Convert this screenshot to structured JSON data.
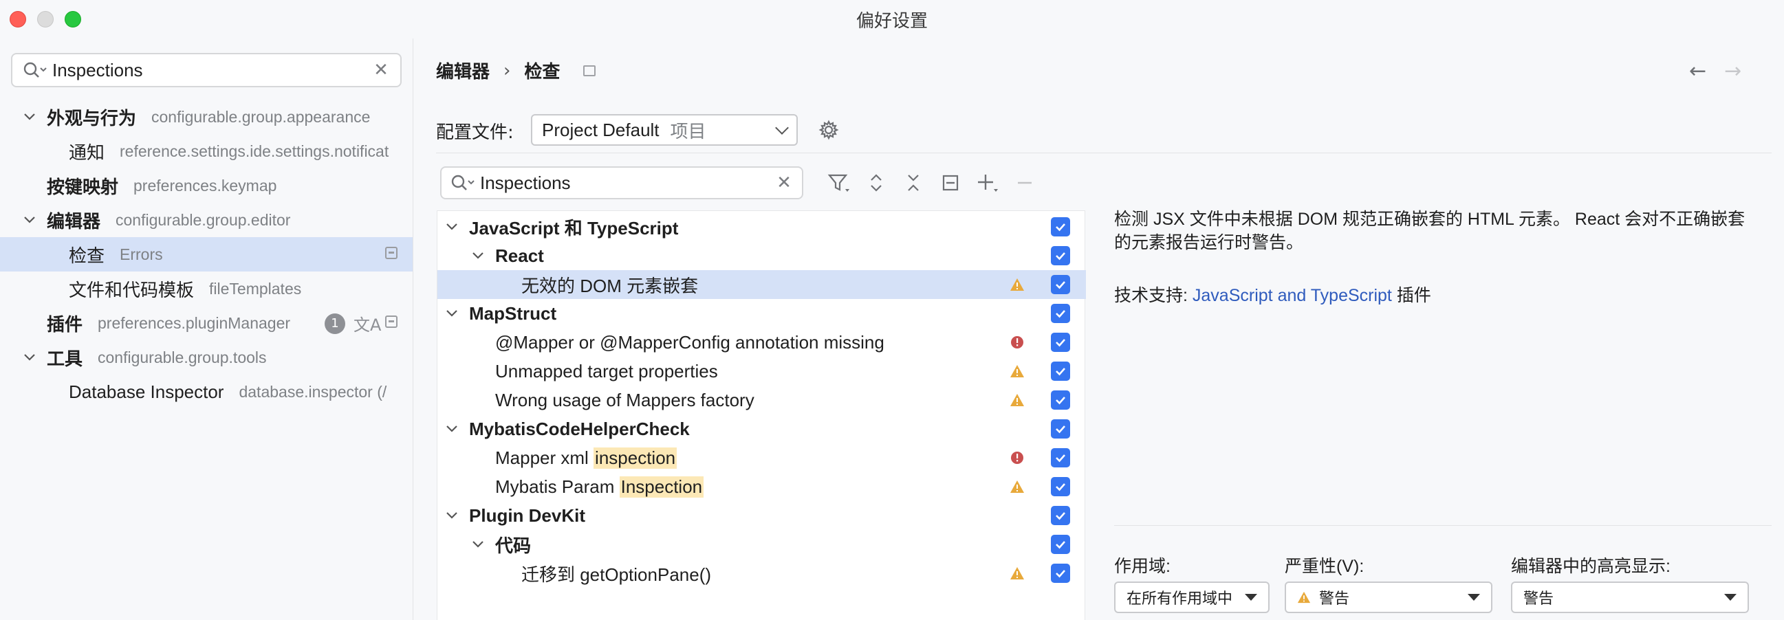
{
  "window": {
    "title": "偏好设置"
  },
  "sidebar": {
    "search_value": "Inspections",
    "items": [
      {
        "label": "外观与行为",
        "hint": "configurable.group.appearance"
      },
      {
        "label": "通知",
        "hint": "reference.settings.ide.settings.notificat"
      },
      {
        "label": "按键映射",
        "hint": "preferences.keymap"
      },
      {
        "label": "编辑器",
        "hint": "configurable.group.editor"
      },
      {
        "label": "检查",
        "hint": "Errors"
      },
      {
        "label": "文件和代码模板",
        "hint": "fileTemplates"
      },
      {
        "label": "插件",
        "hint": "preferences.pluginManager",
        "badge": "1"
      },
      {
        "label": "工具",
        "hint": "configurable.group.tools"
      },
      {
        "label": "Database Inspector",
        "hint": "database.inspector (/"
      }
    ]
  },
  "header": {
    "crumb1": "编辑器",
    "sep": "›",
    "crumb2": "检查",
    "back_icon": "arrow-left-icon",
    "forward_icon": "arrow-right-icon"
  },
  "profile": {
    "label": "配置文件:",
    "value": "Project Default",
    "sub": "项目"
  },
  "inspections": {
    "search_value": "Inspections",
    "rows": [
      {
        "label": "JavaScript 和 TypeScript"
      },
      {
        "label": "React"
      },
      {
        "label": "无效的 DOM 元素嵌套"
      },
      {
        "label": "MapStruct"
      },
      {
        "label": "@Mapper or @MapperConfig annotation missing"
      },
      {
        "label": "Unmapped target properties"
      },
      {
        "label": "Wrong usage of Mappers factory"
      },
      {
        "label": "MybatisCodeHelperCheck"
      },
      {
        "label_pre": "Mapper xml ",
        "label_hl": "inspection"
      },
      {
        "label_pre": "Mybatis Param ",
        "label_hl": "Inspection"
      },
      {
        "label": "Plugin DevKit"
      },
      {
        "label": "代码"
      },
      {
        "label": "迁移到 getOptionPane()"
      }
    ]
  },
  "description": {
    "text": "检测 JSX 文件中未根据 DOM 规范正确嵌套的 HTML 元素。 React 会对不正确嵌套的元素报告运行时警告。",
    "support_prefix": "技术支持: ",
    "support_link": "JavaScript and TypeScript",
    "support_suffix": " 插件"
  },
  "options": {
    "scope_label": "作用域:",
    "scope_value": "在所有作用域中",
    "severity_label": "严重性(V):",
    "severity_value": "警告",
    "highlight_label": "编辑器中的高亮显示:",
    "highlight_value": "警告"
  },
  "colors": {
    "accent": "#3574f0",
    "warning": "#e8a93b",
    "error": "#c94f4f",
    "selection": "#d5e1f7",
    "highlight": "#fce8b6"
  }
}
